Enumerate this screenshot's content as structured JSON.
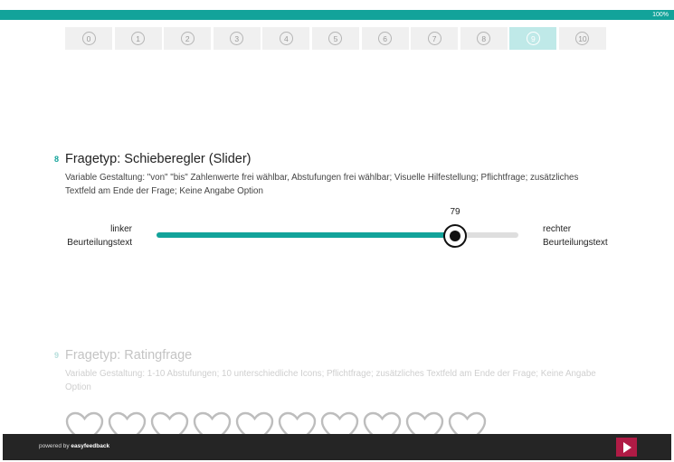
{
  "progress": {
    "label": "100%",
    "percent": 100
  },
  "pager": {
    "pages": [
      "0",
      "1",
      "2",
      "3",
      "4",
      "5",
      "6",
      "7",
      "8",
      "9",
      "10"
    ],
    "active_index": 9
  },
  "question_8": {
    "number": "8",
    "title": "Fragetyp: Schieberegler (Slider)",
    "description": "Variable Gestaltung: \"von\" \"bis\" Zahlenwerte frei wählbar, Abstufungen frei wählbar; Visuelle Hilfestellung; Pflichtfrage; zusätzliches Textfeld am Ende der Frage; Keine Angabe Option",
    "slider": {
      "left_label_line1": "linker",
      "left_label_line2": "Beurteilungstext",
      "right_label_line1": "rechter",
      "right_label_line2": "Beurteilungstext",
      "value": 79,
      "min": 0,
      "max": 100
    }
  },
  "question_9": {
    "number": "9",
    "title": "Fragetyp: Ratingfrage",
    "description": "Variable Gestaltung: 1-10 Abstufungen; 10 unterschiedliche Icons; Pflichtfrage; zusätzliches Textfeld am Ende der Frage; Keine Angabe Option",
    "rating_count": 10,
    "icon": "heart-icon"
  },
  "footer": {
    "powered_prefix": "powered by",
    "brand": "easyfeedback",
    "next_icon": "play-arrow-icon"
  },
  "colors": {
    "accent": "#12a39a",
    "active_page": "#bfe9e8",
    "next_button": "#b01b45",
    "footer_bg": "#252525"
  }
}
